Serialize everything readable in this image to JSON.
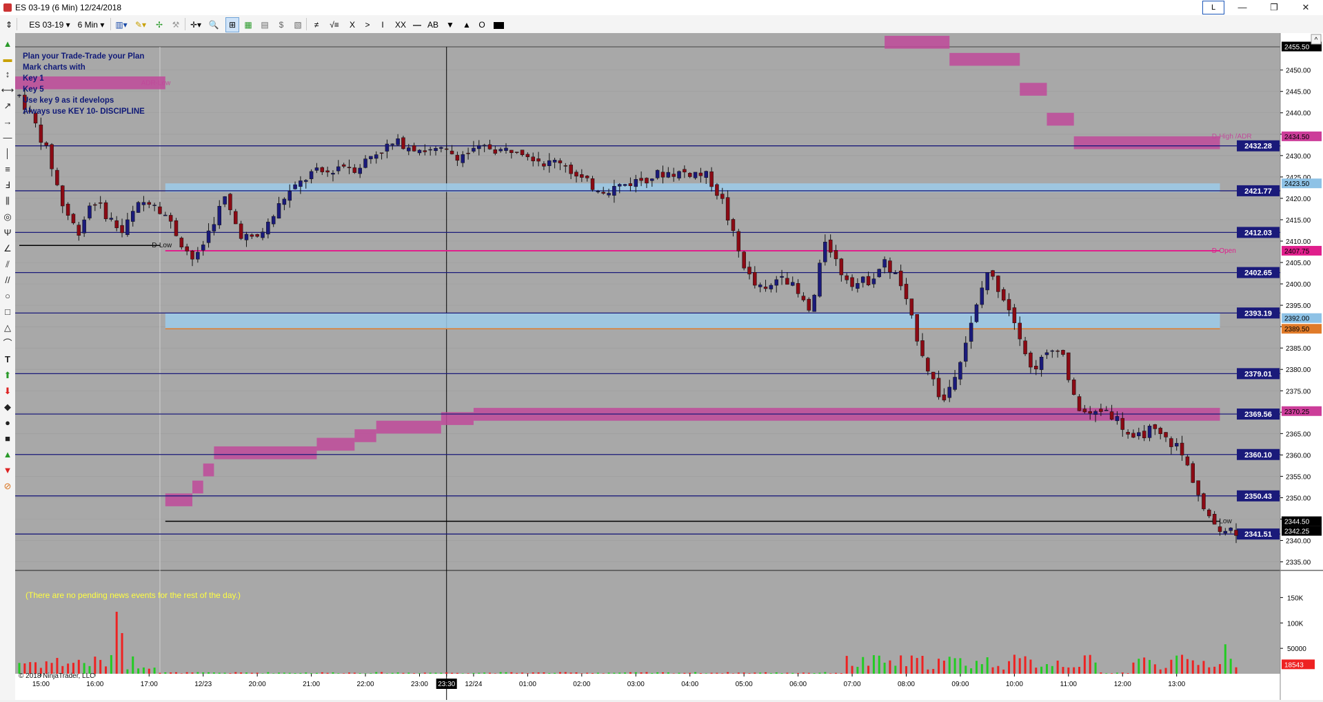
{
  "window": {
    "title": "ES 03-19 (6 Min)  12/24/2018",
    "l_button": "L",
    "minimize": "—",
    "maximize": "❐",
    "close": "✕"
  },
  "toolbar": {
    "instrument": "ES 03-19",
    "interval": "6 Min",
    "tools": [
      "≠",
      "√≡",
      "X",
      ">",
      "I",
      "XX",
      "AB",
      "▼",
      "▲",
      "O"
    ]
  },
  "chart_data": {
    "type": "candlestick",
    "instrument": "ES 03-19",
    "interval": "6 Min",
    "date": "12/24/2018",
    "price_axis": {
      "ylim": [
        2333,
        2458
      ],
      "ticks": [
        2450.0,
        2445.0,
        2440.0,
        2435.0,
        2430.0,
        2425.0,
        2420.0,
        2415.0,
        2410.0,
        2405.0,
        2400.0,
        2395.0,
        2390.0,
        2385.0,
        2380.0,
        2375.0,
        2370.0,
        2365.0,
        2360.0,
        2355.0,
        2350.0,
        2345.0,
        2340.0,
        2335.0
      ]
    },
    "time_labels": [
      {
        "label": "15:00",
        "i": 4
      },
      {
        "label": "16:00",
        "i": 14
      },
      {
        "label": "17:00",
        "i": 24
      },
      {
        "label": "12/23",
        "i": 34
      },
      {
        "label": "20:00",
        "i": 44
      },
      {
        "label": "21:00",
        "i": 54
      },
      {
        "label": "22:00",
        "i": 64
      },
      {
        "label": "23:00",
        "i": 74
      },
      {
        "label": "23:30",
        "i": 79,
        "highlight": true
      },
      {
        "label": "12/24",
        "i": 84
      },
      {
        "label": "01:00",
        "i": 94
      },
      {
        "label": "02:00",
        "i": 104
      },
      {
        "label": "03:00",
        "i": 114
      },
      {
        "label": "04:00",
        "i": 124
      },
      {
        "label": "05:00",
        "i": 134
      },
      {
        "label": "06:00",
        "i": 144
      },
      {
        "label": "07:00",
        "i": 154
      },
      {
        "label": "08:00",
        "i": 164
      },
      {
        "label": "09:00",
        "i": 174
      },
      {
        "label": "10:00",
        "i": 184
      },
      {
        "label": "11:00",
        "i": 194
      },
      {
        "label": "12:00",
        "i": 204
      },
      {
        "label": "13:00",
        "i": 214
      }
    ],
    "price_path": [
      2444,
      2438,
      2430,
      2418,
      2412,
      2420,
      2416,
      2412,
      2418,
      2420,
      2416,
      2410,
      2405,
      2413,
      2420,
      2412,
      2410,
      2414,
      2420,
      2423,
      2426,
      2426,
      2428,
      2427,
      2430,
      2432,
      2433,
      2432,
      2431,
      2431,
      2430,
      2431,
      2432,
      2431,
      2432,
      2430,
      2428,
      2429,
      2425,
      2423,
      2422,
      2423,
      2424,
      2425,
      2426,
      2426,
      2426,
      2425,
      2419,
      2408,
      2400,
      2398,
      2403,
      2398,
      2393,
      2411,
      2403,
      2400,
      2401,
      2405,
      2401,
      2390,
      2380,
      2372,
      2381,
      2391,
      2403,
      2398,
      2391,
      2380,
      2383,
      2386,
      2372,
      2369,
      2371,
      2368,
      2363,
      2366,
      2364,
      2362,
      2355,
      2345,
      2343,
      2342.25
    ],
    "volume_axis": {
      "ylim": [
        0,
        160000
      ],
      "ticks": [
        "150K",
        "100K",
        "50000"
      ],
      "last": "18543"
    },
    "blue_levels": [
      {
        "label": "2432.28",
        "price": 2432.28
      },
      {
        "label": "2421.77",
        "price": 2421.77
      },
      {
        "label": "2412.03",
        "price": 2412.03
      },
      {
        "label": "2402.65",
        "price": 2402.65
      },
      {
        "label": "2393.19",
        "price": 2393.19
      },
      {
        "label": "2379.01",
        "price": 2379.01
      },
      {
        "label": "2369.56",
        "price": 2369.56
      },
      {
        "label": "2360.10",
        "price": 2360.1
      },
      {
        "label": "2350.43",
        "price": 2350.43
      },
      {
        "label": "2341.51",
        "price": 2341.51
      }
    ],
    "price_badges": [
      {
        "label": "2455.50",
        "price": 2455.5,
        "color": "#ffffff",
        "bg": "#000000"
      },
      {
        "label": "2434.50",
        "price": 2434.5,
        "color": "#000000",
        "bg": "#cc3d99"
      },
      {
        "label": "2423.50",
        "price": 2423.5,
        "color": "#000000",
        "bg": "#8ec2e6"
      },
      {
        "label": "2407.75",
        "price": 2407.75,
        "color": "#000000",
        "bg": "#e01f8c"
      },
      {
        "label": "2392.00",
        "price": 2392.0,
        "color": "#000000",
        "bg": "#8ec2e6"
      },
      {
        "label": "2389.50",
        "price": 2389.5,
        "color": "#000000",
        "bg": "#e07b2a"
      },
      {
        "label": "2370.25",
        "price": 2370.25,
        "color": "#000000",
        "bg": "#cc3d99"
      },
      {
        "label": "2344.50",
        "price": 2344.5,
        "color": "#ffffff",
        "bg": "#000000"
      },
      {
        "label": "2342.25",
        "price": 2342.25,
        "color": "#ffffff",
        "bg": "#000000"
      }
    ],
    "line_labels": [
      {
        "label": "ADR-Low",
        "price": 2447,
        "i": 22
      },
      {
        "label": "D-High /ADR",
        "price": 2434.5,
        "i": 220
      },
      {
        "label": "D-Open",
        "price": 2407.75,
        "i": 220
      },
      {
        "label": "D-Low",
        "price": 2344.5,
        "i": 220
      },
      {
        "label": "D-Low",
        "price": 2409,
        "i": 24
      }
    ],
    "colors": {
      "up_candle": "#1a1a7a",
      "down_candle": "#8b0a14",
      "blue_level": "#1a1a7a",
      "d_open": "#e01f8c",
      "adr_band": "#c04a9a",
      "range_band": "#9ccbea",
      "background": "#a8a8a8",
      "volume_up": "#22cc22",
      "volume_down": "#ee2222"
    }
  },
  "notes": {
    "line1": "Plan your Trade-Trade your Plan",
    "line2": "Mark charts with",
    "line3": "Key 1",
    "line4": "Key 5",
    "line5": "Use key 9 as it develops",
    "line6": "Always use KEY 10- DISCIPLINE"
  },
  "news": "(There are no pending news events for the rest of the day.)",
  "copyright": "© 2018 NinjaTrader, LLC"
}
